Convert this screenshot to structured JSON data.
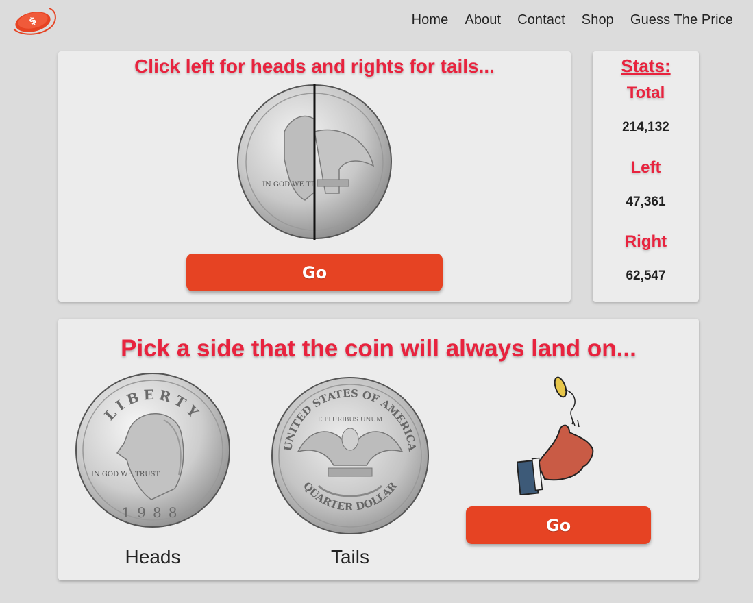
{
  "nav": {
    "items": [
      "Home",
      "About",
      "Contact",
      "Shop",
      "Guess The Price"
    ]
  },
  "top_card": {
    "title": "Click left for heads and rights for tails...",
    "go_label": "Go"
  },
  "stats": {
    "title": "Stats:",
    "total_label": "Total",
    "total_value": "214,132",
    "left_label": "Left",
    "left_value": "47,361",
    "right_label": "Right",
    "right_value": "62,547"
  },
  "bottom_card": {
    "title": "Pick a side that the coin will always land on...",
    "heads_label": "Heads",
    "tails_label": "Tails",
    "go_label": "Go"
  },
  "coin_text": {
    "heads_top": "LIBERTY",
    "heads_motto": "IN GOD WE TRUST",
    "heads_year": "1988",
    "tails_top": "UNITED STATES OF AMERICA",
    "tails_motto": "E PLURIBUS UNUM",
    "tails_bottom": "QUARTER DOLLAR"
  },
  "colors": {
    "accent_red": "#e8233e",
    "button_orange": "#e64323",
    "background": "#dcdcdc",
    "card": "#ececec"
  },
  "icons": {
    "logo": "flipping-coin-logo-icon",
    "hand": "coin-flip-hand-icon"
  }
}
